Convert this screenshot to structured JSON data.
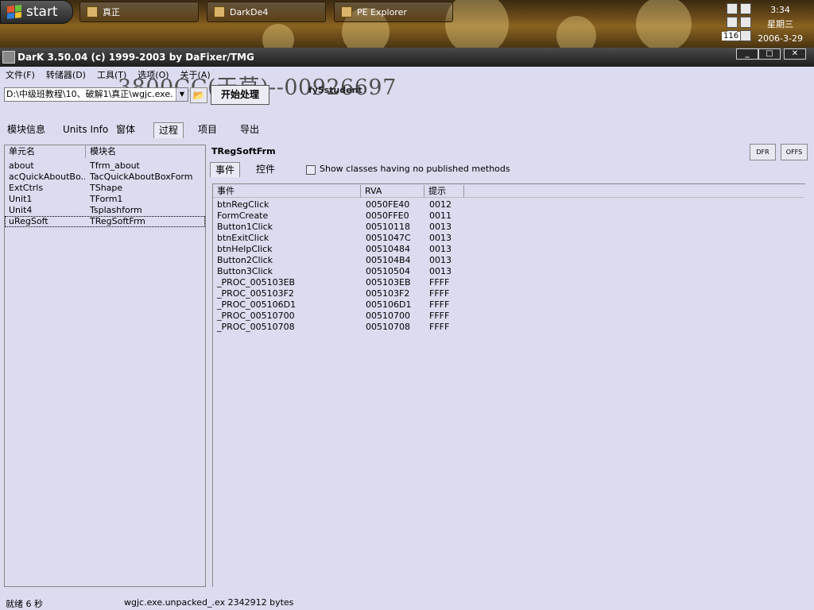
{
  "taskbar": {
    "start_label": "start",
    "tasks": [
      {
        "label": "真正"
      },
      {
        "label": "DarkDe4"
      },
      {
        "label": "PE Explorer"
      }
    ],
    "clock_time": "3:34",
    "clock_day": "星期三",
    "clock_date": "2006-3-29",
    "tray_badge": "116"
  },
  "window": {
    "title": "DarK 3.50.04 (c) 1999-2003 by DaFixer/TMG",
    "controls": [
      "_",
      "□",
      "✕"
    ]
  },
  "menu": [
    "文件(F)",
    "转储器(D)",
    "工具(T)",
    "选项(O)",
    "关于(A)"
  ],
  "watermark": "3800CC(天草)--00926697",
  "toolbar": {
    "path_value": "D:\\中级班教程\\10、破解1\\真正\\wgjc.exe.",
    "process_label": "开始处理",
    "student_label": "fy5student"
  },
  "tabs": [
    "模块信息",
    "Units Info",
    "窗体",
    "过程",
    "项目",
    "导出"
  ],
  "selected_tab": "过程",
  "units": {
    "columns": [
      "单元名",
      "模块名"
    ],
    "rows": [
      [
        "about",
        "Tfrm_about"
      ],
      [
        "acQuickAboutBo...",
        "TacQuickAboutBoxForm"
      ],
      [
        "ExtCtrls",
        "TShape"
      ],
      [
        "Unit1",
        "TForm1"
      ],
      [
        "Unit4",
        "Tsplashform"
      ],
      [
        "uRegSoft",
        "TRegSoftFrm"
      ]
    ],
    "selected_row": 5
  },
  "class_panel": {
    "title": "TRegSoftFrm",
    "dfr_label": "DFR",
    "offs_label": "OFFS",
    "subtabs": [
      "事件",
      "控件"
    ],
    "checkbox_label": "Show classes having no published methods",
    "columns": [
      "事件",
      "RVA",
      "提示"
    ],
    "rows": [
      [
        "btnRegClick",
        "0050FE40",
        "0012"
      ],
      [
        "FormCreate",
        "0050FFE0",
        "0011"
      ],
      [
        "Button1Click",
        "00510118",
        "0013"
      ],
      [
        "btnExitClick",
        "0051047C",
        "0013"
      ],
      [
        "btnHelpClick",
        "00510484",
        "0013"
      ],
      [
        "Button2Click",
        "005104B4",
        "0013"
      ],
      [
        "Button3Click",
        "00510504",
        "0013"
      ],
      [
        "_PROC_005103EB",
        "005103EB",
        "FFFF"
      ],
      [
        "_PROC_005103F2",
        "005103F2",
        "FFFF"
      ],
      [
        "_PROC_005106D1",
        "005106D1",
        "FFFF"
      ],
      [
        "_PROC_00510700",
        "00510700",
        "FFFF"
      ],
      [
        "_PROC_00510708",
        "00510708",
        "FFFF"
      ]
    ]
  },
  "status": {
    "left": "就绪 6 秒",
    "right": "wgjc.exe.unpacked_.ex 2342912 bytes"
  },
  "colors": {
    "background": "#dcdcf0",
    "titlebar": "#1e1e1e",
    "taskbar": "#6b4a1a"
  }
}
